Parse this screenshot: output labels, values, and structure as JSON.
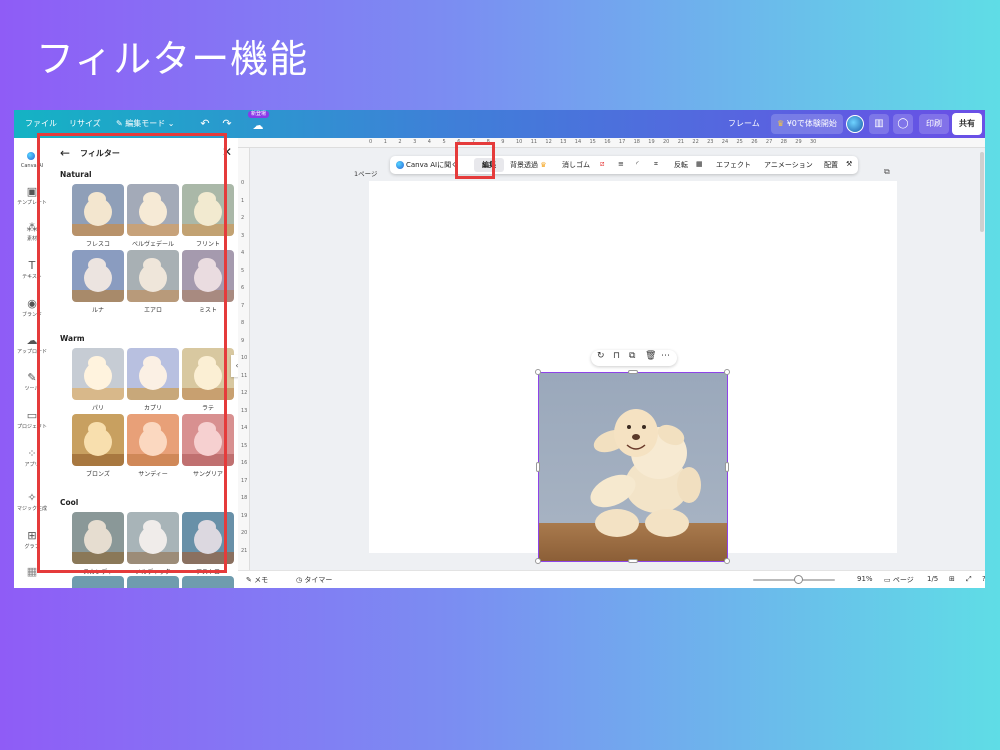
{
  "slide": {
    "title": "フィルター機能"
  },
  "topbar": {
    "file": "ファイル",
    "resize": "リサイズ",
    "edit_mode": "編集モード",
    "new_badge": "新登場",
    "frame": "フレーム",
    "trial": "¥0で体験開始",
    "print": "印刷",
    "share": "共有"
  },
  "rail": [
    {
      "label": "Canva AI",
      "icon": "canva-ai-icon"
    },
    {
      "label": "テンプレート",
      "icon": "template-icon"
    },
    {
      "label": "素材",
      "icon": "elements-icon"
    },
    {
      "label": "テキスト",
      "icon": "text-icon"
    },
    {
      "label": "ブランド",
      "icon": "brand-icon"
    },
    {
      "label": "アップロード",
      "icon": "upload-icon"
    },
    {
      "label": "ツール",
      "icon": "tools-icon"
    },
    {
      "label": "プロジェクト",
      "icon": "project-icon"
    },
    {
      "label": "アプリ",
      "icon": "apps-icon"
    },
    {
      "label": "マジック生成",
      "icon": "magic-icon"
    },
    {
      "label": "グラフ",
      "icon": "chart-icon"
    }
  ],
  "panel": {
    "title": "フィルター",
    "sections": [
      {
        "label": "Natural",
        "items": [
          "フレスコ",
          "ベルヴェデール",
          "フリント",
          "ルナ",
          "エアロ",
          "ミスト"
        ]
      },
      {
        "label": "Warm",
        "items": [
          "パリ",
          "カプリ",
          "ラテ",
          "ブロンズ",
          "サンディー",
          "サングリア"
        ]
      },
      {
        "label": "Cool",
        "items": [
          "スカンディ",
          "ノルディック",
          "アストロ"
        ]
      }
    ]
  },
  "canvas": {
    "page_label": "1ページ",
    "toolbar": {
      "canva_ai": "Canva AIに聞く",
      "edit": "編集",
      "bg_remove": "背景透過",
      "eraser": "消しゴム",
      "flip": "反転",
      "effects": "エフェクト",
      "animation": "アニメーション",
      "arrange": "配置"
    },
    "ruler_top": [
      "0",
      "1",
      "2",
      "3",
      "4",
      "5",
      "6",
      "7",
      "8",
      "9",
      "10",
      "11",
      "12",
      "13",
      "14",
      "15",
      "16",
      "17",
      "18",
      "19",
      "20",
      "21",
      "22",
      "23",
      "24",
      "25",
      "26",
      "27",
      "28",
      "29",
      "30"
    ],
    "ruler_left": [
      "0",
      "1",
      "2",
      "3",
      "4",
      "5",
      "6",
      "7",
      "8",
      "9",
      "10",
      "11",
      "12",
      "13",
      "14",
      "15",
      "16",
      "17",
      "18",
      "19",
      "20",
      "21"
    ]
  },
  "bottombar": {
    "notes": "メモ",
    "timer": "タイマー",
    "zoom": "91%",
    "pages": "ページ",
    "page_count": "1/5"
  }
}
